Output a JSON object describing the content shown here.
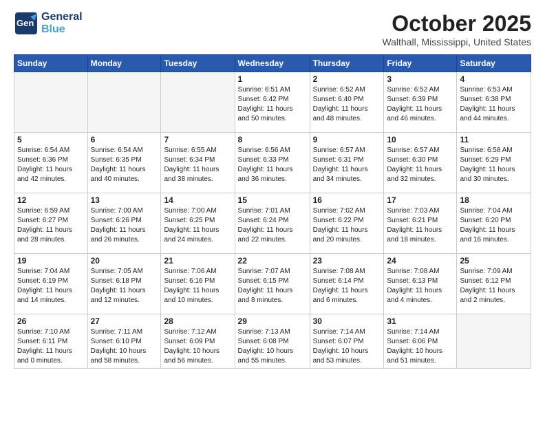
{
  "header": {
    "logo_line1": "General",
    "logo_line2": "Blue",
    "month": "October 2025",
    "location": "Walthall, Mississippi, United States"
  },
  "weekdays": [
    "Sunday",
    "Monday",
    "Tuesday",
    "Wednesday",
    "Thursday",
    "Friday",
    "Saturday"
  ],
  "weeks": [
    [
      {
        "day": "",
        "info": ""
      },
      {
        "day": "",
        "info": ""
      },
      {
        "day": "",
        "info": ""
      },
      {
        "day": "1",
        "info": "Sunrise: 6:51 AM\nSunset: 6:42 PM\nDaylight: 11 hours\nand 50 minutes."
      },
      {
        "day": "2",
        "info": "Sunrise: 6:52 AM\nSunset: 6:40 PM\nDaylight: 11 hours\nand 48 minutes."
      },
      {
        "day": "3",
        "info": "Sunrise: 6:52 AM\nSunset: 6:39 PM\nDaylight: 11 hours\nand 46 minutes."
      },
      {
        "day": "4",
        "info": "Sunrise: 6:53 AM\nSunset: 6:38 PM\nDaylight: 11 hours\nand 44 minutes."
      }
    ],
    [
      {
        "day": "5",
        "info": "Sunrise: 6:54 AM\nSunset: 6:36 PM\nDaylight: 11 hours\nand 42 minutes."
      },
      {
        "day": "6",
        "info": "Sunrise: 6:54 AM\nSunset: 6:35 PM\nDaylight: 11 hours\nand 40 minutes."
      },
      {
        "day": "7",
        "info": "Sunrise: 6:55 AM\nSunset: 6:34 PM\nDaylight: 11 hours\nand 38 minutes."
      },
      {
        "day": "8",
        "info": "Sunrise: 6:56 AM\nSunset: 6:33 PM\nDaylight: 11 hours\nand 36 minutes."
      },
      {
        "day": "9",
        "info": "Sunrise: 6:57 AM\nSunset: 6:31 PM\nDaylight: 11 hours\nand 34 minutes."
      },
      {
        "day": "10",
        "info": "Sunrise: 6:57 AM\nSunset: 6:30 PM\nDaylight: 11 hours\nand 32 minutes."
      },
      {
        "day": "11",
        "info": "Sunrise: 6:58 AM\nSunset: 6:29 PM\nDaylight: 11 hours\nand 30 minutes."
      }
    ],
    [
      {
        "day": "12",
        "info": "Sunrise: 6:59 AM\nSunset: 6:27 PM\nDaylight: 11 hours\nand 28 minutes."
      },
      {
        "day": "13",
        "info": "Sunrise: 7:00 AM\nSunset: 6:26 PM\nDaylight: 11 hours\nand 26 minutes."
      },
      {
        "day": "14",
        "info": "Sunrise: 7:00 AM\nSunset: 6:25 PM\nDaylight: 11 hours\nand 24 minutes."
      },
      {
        "day": "15",
        "info": "Sunrise: 7:01 AM\nSunset: 6:24 PM\nDaylight: 11 hours\nand 22 minutes."
      },
      {
        "day": "16",
        "info": "Sunrise: 7:02 AM\nSunset: 6:22 PM\nDaylight: 11 hours\nand 20 minutes."
      },
      {
        "day": "17",
        "info": "Sunrise: 7:03 AM\nSunset: 6:21 PM\nDaylight: 11 hours\nand 18 minutes."
      },
      {
        "day": "18",
        "info": "Sunrise: 7:04 AM\nSunset: 6:20 PM\nDaylight: 11 hours\nand 16 minutes."
      }
    ],
    [
      {
        "day": "19",
        "info": "Sunrise: 7:04 AM\nSunset: 6:19 PM\nDaylight: 11 hours\nand 14 minutes."
      },
      {
        "day": "20",
        "info": "Sunrise: 7:05 AM\nSunset: 6:18 PM\nDaylight: 11 hours\nand 12 minutes."
      },
      {
        "day": "21",
        "info": "Sunrise: 7:06 AM\nSunset: 6:16 PM\nDaylight: 11 hours\nand 10 minutes."
      },
      {
        "day": "22",
        "info": "Sunrise: 7:07 AM\nSunset: 6:15 PM\nDaylight: 11 hours\nand 8 minutes."
      },
      {
        "day": "23",
        "info": "Sunrise: 7:08 AM\nSunset: 6:14 PM\nDaylight: 11 hours\nand 6 minutes."
      },
      {
        "day": "24",
        "info": "Sunrise: 7:08 AM\nSunset: 6:13 PM\nDaylight: 11 hours\nand 4 minutes."
      },
      {
        "day": "25",
        "info": "Sunrise: 7:09 AM\nSunset: 6:12 PM\nDaylight: 11 hours\nand 2 minutes."
      }
    ],
    [
      {
        "day": "26",
        "info": "Sunrise: 7:10 AM\nSunset: 6:11 PM\nDaylight: 11 hours\nand 0 minutes."
      },
      {
        "day": "27",
        "info": "Sunrise: 7:11 AM\nSunset: 6:10 PM\nDaylight: 10 hours\nand 58 minutes."
      },
      {
        "day": "28",
        "info": "Sunrise: 7:12 AM\nSunset: 6:09 PM\nDaylight: 10 hours\nand 56 minutes."
      },
      {
        "day": "29",
        "info": "Sunrise: 7:13 AM\nSunset: 6:08 PM\nDaylight: 10 hours\nand 55 minutes."
      },
      {
        "day": "30",
        "info": "Sunrise: 7:14 AM\nSunset: 6:07 PM\nDaylight: 10 hours\nand 53 minutes."
      },
      {
        "day": "31",
        "info": "Sunrise: 7:14 AM\nSunset: 6:06 PM\nDaylight: 10 hours\nand 51 minutes."
      },
      {
        "day": "",
        "info": ""
      }
    ]
  ]
}
